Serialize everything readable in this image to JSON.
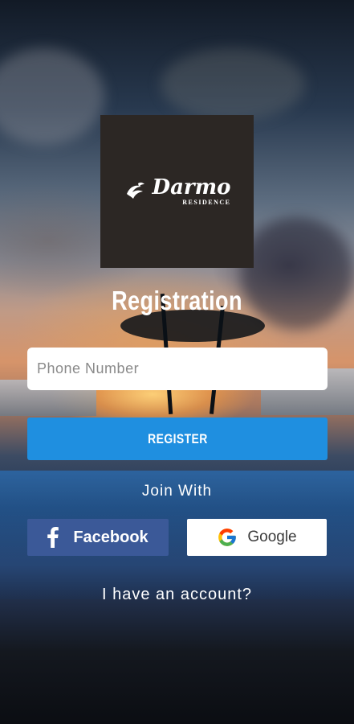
{
  "logo": {
    "brand_name": "Darmo",
    "brand_sub": "RESIDENCE"
  },
  "page": {
    "title": "Registration"
  },
  "form": {
    "phone_placeholder": "Phone Number",
    "register_label": "REGISTER"
  },
  "social": {
    "join_label": "Join With",
    "facebook_label": "Facebook",
    "google_label": "Google"
  },
  "footer": {
    "account_link": "I have an account?"
  },
  "colors": {
    "register_button": "#1f8fe0",
    "facebook_button": "#3b5998",
    "logo_background": "#2c2724"
  },
  "icons": {
    "facebook": "facebook-icon",
    "google": "google-icon",
    "logo_mark": "bird-logo-icon"
  }
}
